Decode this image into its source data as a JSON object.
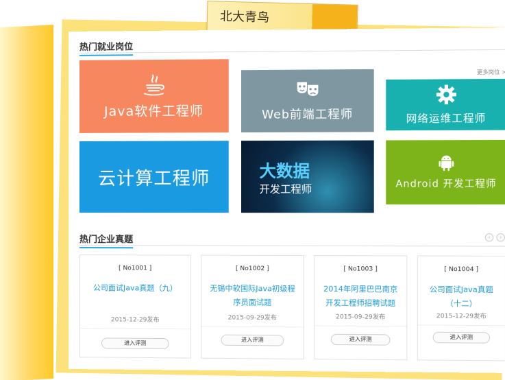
{
  "header": {
    "brand": "北大青鸟"
  },
  "jobs": {
    "section_title": "热门就业岗位",
    "more_label": "更多岗位 >",
    "tiles": [
      {
        "label": "Java软件工程师",
        "color": "#f7875f",
        "icon": "java-cup-icon"
      },
      {
        "label": "Web前端工程师",
        "color": "#7e97a1",
        "icon": "theater-masks-icon"
      },
      {
        "label": "网络运维工程师",
        "color": "#18b1b0",
        "icon": "gear-icon"
      },
      {
        "label": "云计算工程师",
        "color": "#1a9ae0",
        "icon": ""
      },
      {
        "label": "大数据",
        "sublabel": "开发工程师",
        "color": "#0b2c4a",
        "icon": ""
      },
      {
        "label": "Android 开发工程师",
        "color": "#7cb419",
        "icon": "android-icon"
      }
    ]
  },
  "exams": {
    "section_title": "热门企业真题",
    "items": [
      {
        "no": "[ No1001 ]",
        "title": "公司面试Java真题（九）",
        "date": "2015-12-29发布",
        "button": "进入评测"
      },
      {
        "no": "[ No1002 ]",
        "title": "无锡中软国际Java初级程序员面试题",
        "date": "2015-09-29发布",
        "button": "进入评测"
      },
      {
        "no": "[ No1003 ]",
        "title": "2014年阿里巴巴南京开发工程师招聘试题",
        "date": "2015-09-29发布",
        "button": "进入评测"
      },
      {
        "no": "[ No1004 ]",
        "title": "公司面试Java真题（十二）",
        "date": "2015-12-29发布",
        "button": "进入评测"
      }
    ]
  }
}
